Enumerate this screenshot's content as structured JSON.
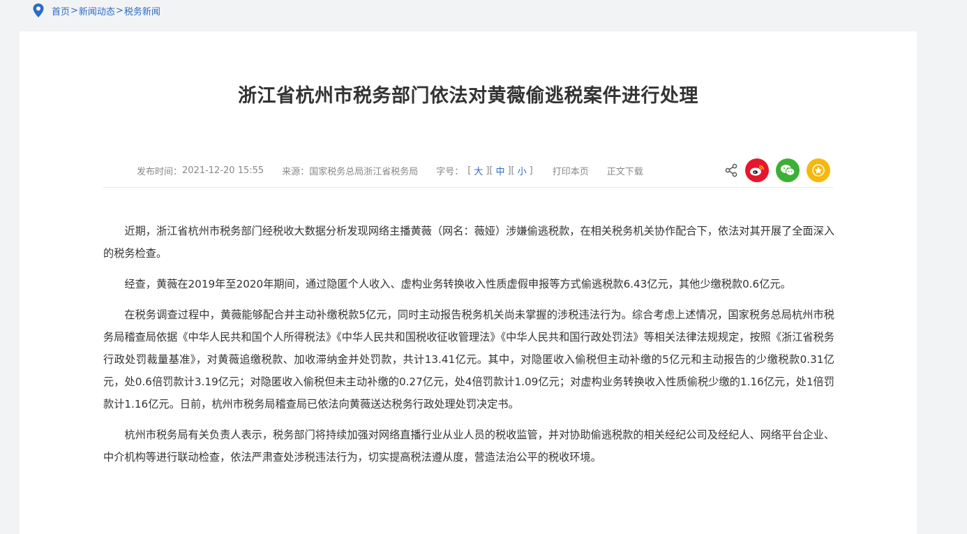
{
  "breadcrumb": {
    "items": [
      "首页",
      "新闻动态",
      "税务新闻"
    ],
    "separator": ">"
  },
  "article": {
    "title": "浙江省杭州市税务部门依法对黄薇偷逃税案件进行处理",
    "meta": {
      "publish_label": "发布时间：",
      "publish_time": "2021-12-20 15:55",
      "source_label": "来源：",
      "source": "国家税务总局浙江省税务局",
      "font_label": "字号：",
      "font_large": "大",
      "font_medium": "中",
      "font_small": "小",
      "print_label": "打印本页",
      "download_label": "正文下载"
    },
    "paragraphs": [
      "近期，浙江省杭州市税务部门经税收大数据分析发现网络主播黄薇（网名：薇娅）涉嫌偷逃税款，在相关税务机关协作配合下，依法对其开展了全面深入的税务检查。",
      "经查，黄薇在2019年至2020年期间，通过隐匿个人收入、虚构业务转换收入性质虚假申报等方式偷逃税款6.43亿元，其他少缴税款0.6亿元。",
      "在税务调查过程中，黄薇能够配合并主动补缴税款5亿元，同时主动报告税务机关尚未掌握的涉税违法行为。综合考虑上述情况，国家税务总局杭州市税务局稽查局依据《中华人民共和国个人所得税法》《中华人民共和国税收征收管理法》《中华人民共和国行政处罚法》等相关法律法规规定，按照《浙江省税务行政处罚裁量基准》，对黄薇追缴税款、加收滞纳金并处罚款，共计13.41亿元。其中，对隐匿收入偷税但主动补缴的5亿元和主动报告的少缴税款0.31亿元，处0.6倍罚款计3.19亿元；对隐匿收入偷税但未主动补缴的0.27亿元，处4倍罚款计1.09亿元；对虚构业务转换收入性质偷税少缴的1.16亿元，处1倍罚款计1.16亿元。日前，杭州市税务局稽查局已依法向黄薇送达税务行政处理处罚决定书。",
      "杭州市税务局有关负责人表示，税务部门将持续加强对网络直播行业从业人员的税收监管，并对协助偷逃税款的相关经纪公司及经纪人、网络平台企业、中介机构等进行联动检查，依法严肃查处涉税违法行为，切实提高税法遵从度，营造法治公平的税收环境。"
    ]
  },
  "share": {
    "share_icon": "share-nodes-icon",
    "weibo": {
      "icon": "weibo-icon",
      "color": "#e6162d"
    },
    "wechat": {
      "icon": "wechat-icon",
      "color": "#3cb034"
    },
    "favorite": {
      "icon": "star-icon",
      "color": "#f5b80e"
    }
  },
  "colors": {
    "link": "#2b6cc4",
    "background": "#f2f3f5"
  }
}
